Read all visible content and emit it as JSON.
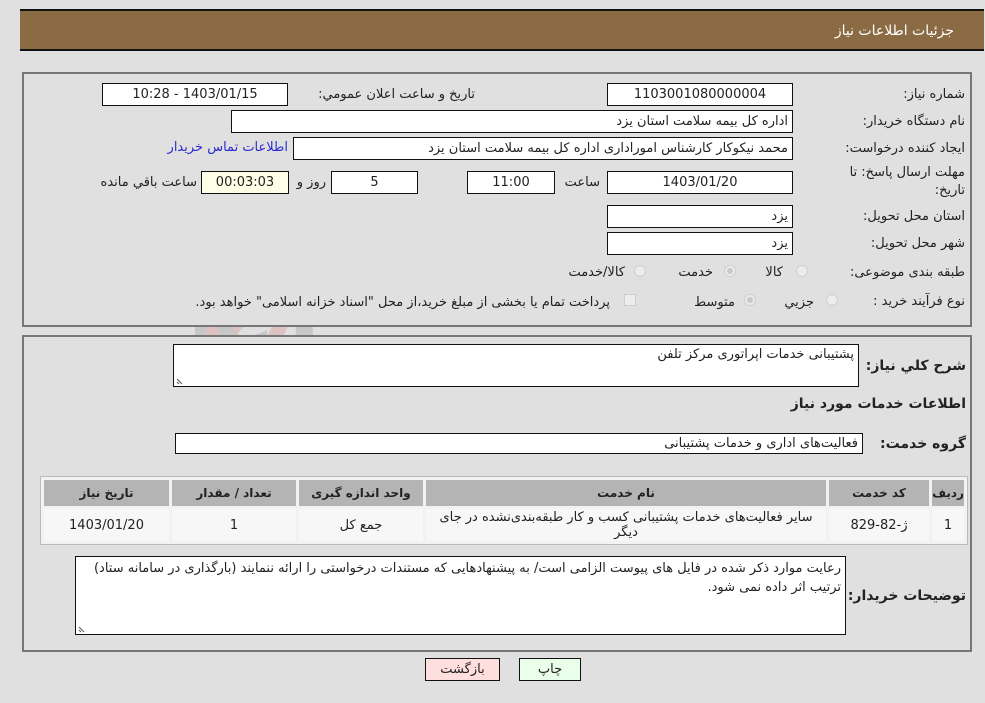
{
  "header": {
    "title": "جزئیات اطلاعات نیاز"
  },
  "fields": {
    "need_number": {
      "label": "شماره نیاز:",
      "value": "1103001080000004"
    },
    "announce": {
      "label": "تاریخ و ساعت اعلان عمومي:",
      "value": "1403/01/15 - 10:28"
    },
    "buyer_org": {
      "label": "نام دستگاه خریدار:",
      "value": "اداره کل بیمه سلامت استان یزد"
    },
    "requester": {
      "label": "ایجاد کننده درخواست:",
      "value": "محمد نیکوکار کارشناس امورادارى  اداره کل بیمه سلامت استان یزد"
    },
    "contact_link": "اطلاعات تماس خریدار",
    "deadline": {
      "label": "مهلت ارسال پاسخ: تا تاریخ:",
      "date": "1403/01/20",
      "time_label": "ساعت",
      "time": "11:00",
      "days": "5",
      "days_label": "روز و",
      "remaining": "00:03:03",
      "remaining_label": "ساعت باقي مانده"
    },
    "province": {
      "label": "استان محل تحویل:",
      "value": "یزد"
    },
    "city": {
      "label": "شهر محل تحویل:",
      "value": "یزد"
    },
    "category": {
      "label": "طبقه بندی موضوعی:",
      "options": [
        "کالا",
        "خدمت",
        "کالا/خدمت"
      ],
      "selected": "خدمت"
    },
    "purchase_type": {
      "label": "نوع فرآیند خرید :",
      "options": [
        "جزیي",
        "متوسط"
      ],
      "selected": "متوسط",
      "treasury_note": "پرداخت تمام یا بخشی از مبلغ خرید،از محل \"اسناد خزانه اسلامی\" خواهد بود."
    }
  },
  "description": {
    "label": "شرح کلي نیاز:",
    "value": "پشتیبانی خدمات اپراتوری مرکز تلفن"
  },
  "services_section": {
    "title": "اطلاعات خدمات مورد نیاز"
  },
  "service_group": {
    "label": "گروه خدمت:",
    "value": "فعالیت‌های اداری و خدمات پشتیبانی"
  },
  "table": {
    "columns": [
      "ردیف",
      "کد خدمت",
      "نام خدمت",
      "واحد اندازه گیری",
      "تعداد / مقدار",
      "تاریخ نیاز"
    ],
    "rows": [
      {
        "row": "1",
        "code": "ژ-82-829",
        "name": "سایر فعالیت‌های خدمات پشتیبانی کسب و کار طبقه‌بندی‌نشده در جای دیگر",
        "unit": "جمع کل",
        "qty": "1",
        "date": "1403/01/20"
      }
    ]
  },
  "buyer_notes": {
    "label": "توضیحات خریدار:",
    "value": "رعایت موارد ذکر شده در فایل های پیوست الزامی است/ به پیشنهادهایی که مستندات درخواستی را ارائه ننمایند (بارگذاری در سامانه ستاد) ترتیب اثر داده نمی شود."
  },
  "buttons": {
    "print": "چاپ",
    "back": "بازگشت"
  },
  "colors": {
    "header_bg": "#8b6b43",
    "print_bg": "#eaffea",
    "back_bg": "#ffdede",
    "link": "#2a2ad0"
  },
  "watermark": "AriaTender.neT"
}
